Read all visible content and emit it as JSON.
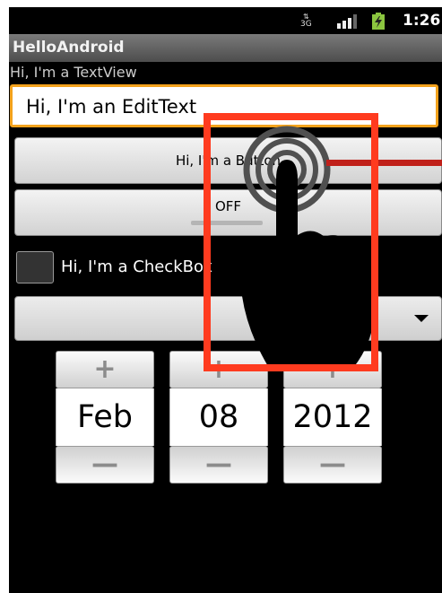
{
  "status_bar": {
    "network_type": "3G",
    "signal_icon": "signal-bars-icon",
    "battery_icon": "battery-charging-icon",
    "time": "1:26",
    "battery_color": "#8bc53f"
  },
  "title_bar": {
    "title": "HelloAndroid"
  },
  "textview": {
    "text": "Hi, I'm a TextView"
  },
  "edittext": {
    "value": "Hi, I'm an EditText",
    "focus_color": "#f3a21c"
  },
  "button": {
    "label": "Hi, I'm a Button"
  },
  "toggle": {
    "label": "OFF",
    "checked": false
  },
  "checkbox": {
    "label": "Hi, I'm a CheckBox",
    "checked": false
  },
  "spinner": {
    "selected": "",
    "icon": "dropdown-arrow-icon"
  },
  "date_picker": {
    "month": "Feb",
    "day": "08",
    "year": "2012",
    "increment_icon": "plus-icon",
    "decrement_icon": "minus-icon"
  },
  "overlay": {
    "highlight_color": "#ff3b1f",
    "touch_icon": "tap-gesture-hand-icon"
  }
}
